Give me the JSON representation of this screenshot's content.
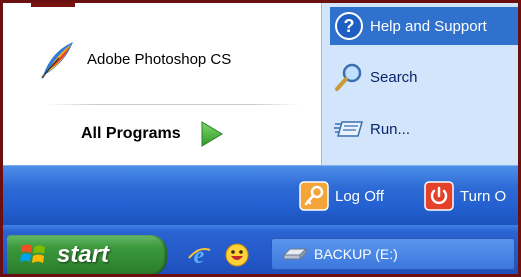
{
  "programs": [
    {
      "label": "Adobe Photoshop CS",
      "icon": "photoshop-feather-icon"
    }
  ],
  "all_programs": {
    "label": "All Programs",
    "icon": "green-arrow-icon"
  },
  "right_menu": {
    "items": [
      {
        "label": "Help and Support",
        "icon": "help-icon",
        "highlighted": true
      },
      {
        "label": "Search",
        "icon": "search-icon"
      },
      {
        "label": "Run...",
        "icon": "run-icon"
      }
    ]
  },
  "bottom": {
    "log_off": "Log Off",
    "turn_off": "Turn O"
  },
  "taskbar": {
    "start_label": "start",
    "quick_launch": [
      "internet-explorer-icon",
      "messenger-smiley-icon"
    ],
    "tasks": [
      {
        "label": "BACKUP (E:)",
        "icon": "drive-icon"
      }
    ]
  },
  "colors": {
    "frame": "#6b1010",
    "right_pane": "#d3e5fa",
    "highlight": "#2f71cd",
    "band": "#235fcf",
    "start_green": "#3d9a3d"
  }
}
